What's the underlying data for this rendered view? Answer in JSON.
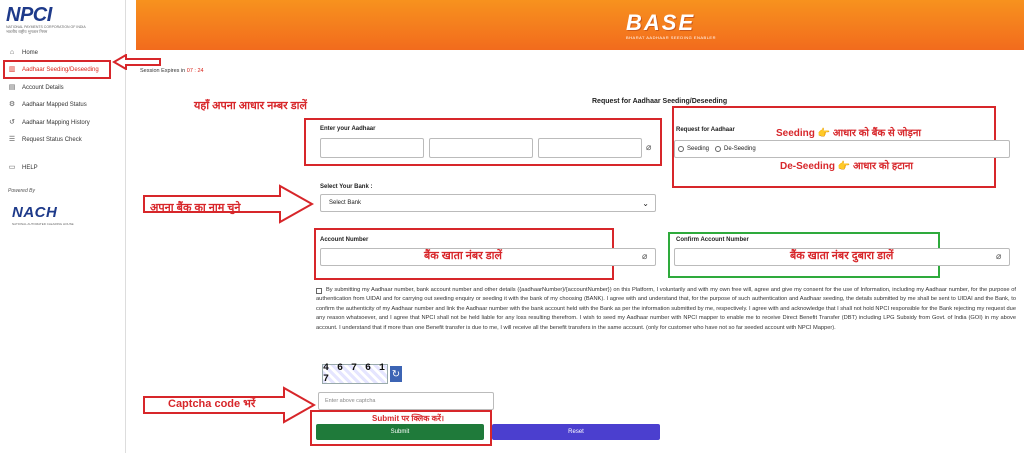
{
  "sidebar": {
    "logo_text": "NPCI",
    "logo_sub": "NATIONAL PAYMENTS CORPORATION OF INDIA",
    "logo_hindi": "भारतीय राष्ट्रीय भुगतान निगम",
    "items": [
      {
        "label": "Home",
        "icon": "home-icon"
      },
      {
        "label": "Aadhaar Seeding/Deseeding",
        "icon": "bank-icon"
      },
      {
        "label": "Account Details",
        "icon": "file-icon"
      },
      {
        "label": "Aadhaar Mapped Status",
        "icon": "gear-icon"
      },
      {
        "label": "Aadhaar Mapping History",
        "icon": "history-icon"
      },
      {
        "label": "Request Status Check",
        "icon": "list-icon"
      },
      {
        "label": "HELP",
        "icon": "doc-icon"
      }
    ],
    "powered_by": "Powered By",
    "nach_text": "NACH",
    "nach_sub": "NATIONAL AUTOMATED CLEARING HOUSE"
  },
  "header": {
    "brand": "BASE",
    "tagline": "BHARAT AADHAAR SEEDING ENABLER"
  },
  "session": {
    "label": "Session Expires in",
    "time": "07 : 24"
  },
  "page_title": "Request for Aadhaar Seeding/Deseeding",
  "form": {
    "aadhaar_label": "Enter your Aadhaar",
    "request_label": "Request for Aadhaar",
    "radio_seeding": "Seeding",
    "radio_deseeding": "De-Seeding",
    "bank_label": "Select Your Bank :",
    "bank_selected": "Select Bank",
    "account_label": "Account Number",
    "confirm_account_label": "Confirm Account Number",
    "consent_text": "By submitting my Aadhaar number, bank account number and other details ({aadhaarNumber}/{accountNumber}) on this Platform, I voluntarily and with my own free will, agree and give my consent for the use of Information, including my Aadhaar number, for the purpose of authentication from UIDAI and for carrying out seeding enquiry or seeding it with the bank of my choosing (BANK). I agree with and understand that, for the purpose of such authentication and Aadhaar seeding, the details submitted by me shall be sent to UIDAI and the Bank, to confirm the authenticity of my Aadhaar number and link the Aadhaar number with the bank account held with the Bank as per the information submitted by me, respectively. I agree with and acknowledge that I shall not hold NPCI responsible for the Bank rejecting my request due any reason whatsoever, and I agree that NPCI shall not be held liable for any loss resulting therefrom. I wish to seed my Aadhaar number with NPCI mapper to enable me to receive Direct Benefit Transfer (DBT) including LPG Subsidy from Govt. of India (GOI) in my above account. I understand that if more than one Benefit transfer is due to me, I will receive all the benefit transfers in the same account. (only for customer who have not so far seeded account with NPCI Mapper).",
    "captcha_text": "4 6 7 6 1 7",
    "captcha_placeholder": "Enter above captcha",
    "submit_label": "Submit",
    "reset_label": "Reset"
  },
  "annotations": {
    "aadhaar_hint": "यहाँ अपना आधार नम्बर डालें",
    "seeding_hint": "Seeding 👉 आधार को बैंक से जोड़ना",
    "deseeding_hint": "De-Seeding 👉 आधार को हटाना",
    "bank_hint": "अपना बैंक का नाम चुने",
    "account_hint": "बैंक खाता नंबर डालें",
    "confirm_account_hint": "बैंक खाता नंबर दुबारा डालें",
    "captcha_hint": "Captcha code भरें",
    "submit_hint": "Submit पर क्लिक करें।"
  }
}
